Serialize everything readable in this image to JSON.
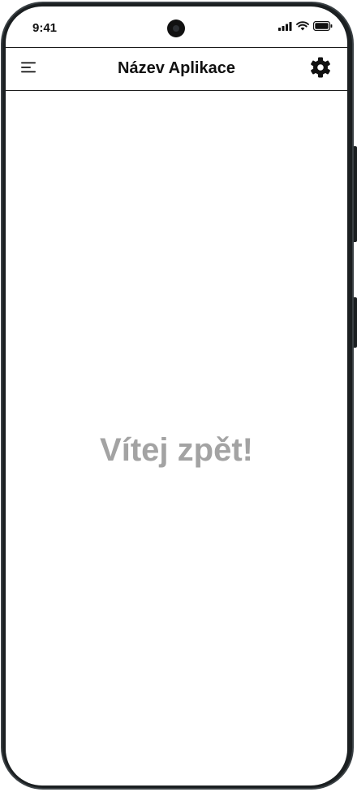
{
  "status_bar": {
    "time": "9:41",
    "icons": [
      "signal-icon",
      "wifi-icon",
      "battery-icon"
    ]
  },
  "header": {
    "menu_icon": "hamburger-menu-icon",
    "title": "Název Aplikace",
    "settings_icon": "gear-icon"
  },
  "main": {
    "welcome_text": "Vítej zpět!"
  },
  "colors": {
    "frame": "#1b1f21",
    "screen_background": "#ffffff",
    "title_text": "#111111",
    "welcome_text": "#a3a3a3",
    "divider": "#1a1a1a"
  }
}
